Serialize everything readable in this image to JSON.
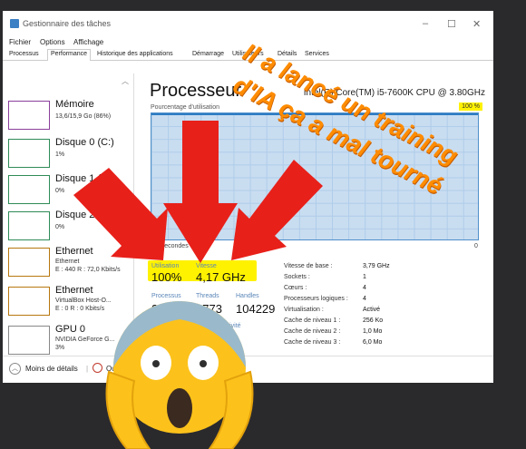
{
  "window": {
    "title": "Gestionnaire des tâches",
    "controls": [
      "–",
      "☐",
      "✕"
    ],
    "menu": [
      "Fichier",
      "Options",
      "Affichage"
    ],
    "tabs": [
      "Processus",
      "Performance",
      "Historique des applications",
      "Démarrage",
      "Utilisateurs",
      "Détails",
      "Services"
    ]
  },
  "sidebar": {
    "items": [
      {
        "name": "Mémoire",
        "sub": "13,6/15,9 Go (86%)"
      },
      {
        "name": "Disque 0 (C:)",
        "sub": "1%"
      },
      {
        "name": "Disque 1 (D:)",
        "sub": "0%"
      },
      {
        "name": "Disque 2",
        "sub": "0%"
      },
      {
        "name": "Ethernet",
        "sub": "Ethernet",
        "sub2": "E : 440 R : 72,0 Kbits/s"
      },
      {
        "name": "Ethernet",
        "sub": "VirtualBox Host-O...",
        "sub2": "E : 0 R : 0 Kbits/s"
      },
      {
        "name": "GPU 0",
        "sub": "NVIDIA GeForce G...",
        "sub2": "3%"
      }
    ]
  },
  "footer": {
    "less_details": "Moins de détails",
    "monitor": "Ouvrir le Moniteur de ressources"
  },
  "main": {
    "title": "Processeur",
    "cpu": "Intel(R) Core(TM) i5-7600K CPU @ 3.80GHz",
    "graph_label": "Pourcentage d'utilisation",
    "graph_max": "100 %",
    "graph_time": "60 secondes",
    "graph_zero": "0",
    "utilization_level": 1.0,
    "stats": {
      "util_label": "Utilisation",
      "util_value": "100%",
      "speed_label": "Vitesse",
      "speed_value": "4,17 GHz",
      "proc_label": "Processus",
      "proc_value": "239",
      "threads_label": "Threads",
      "threads_value": "2773",
      "handles_label": "Handles",
      "handles_value": "104229",
      "uptime_label": "Temps d'activité"
    },
    "specs": [
      {
        "label": "Vitesse de base :",
        "value": "3,79 GHz"
      },
      {
        "label": "Sockets :",
        "value": "1"
      },
      {
        "label": "Cœurs :",
        "value": "4"
      },
      {
        "label": "Processeurs logiques :",
        "value": "4"
      },
      {
        "label": "Virtualisation :",
        "value": "Activé"
      },
      {
        "label": "Cache de niveau 1 :",
        "value": "256 Ko"
      },
      {
        "label": "Cache de niveau 2 :",
        "value": "1,0 Mo"
      },
      {
        "label": "Cache de niveau 3 :",
        "value": "6,0 Mo"
      }
    ]
  },
  "meme": {
    "caption_1": "Il a lancé un training",
    "caption_2": "d'IA ça a mal tourné",
    "caption_color": "#ff8c00",
    "arrow_color": "#e8201a",
    "emoji": "😱",
    "emoji_name": "face-screaming-in-fear"
  }
}
